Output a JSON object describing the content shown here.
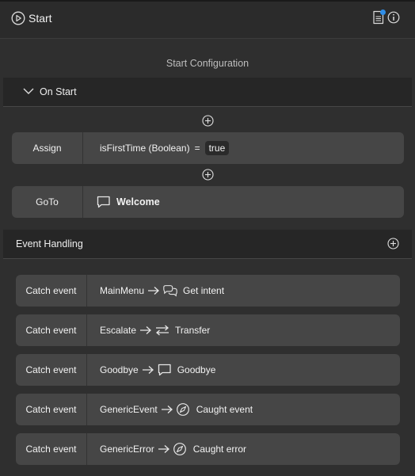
{
  "header": {
    "title": "Start",
    "play_icon": "play-circle-icon",
    "notes_icon": "document-icon",
    "info_icon": "info-icon",
    "accent_color": "#2f8ee8"
  },
  "section_caption": "Start Configuration",
  "on_start": {
    "label": "On Start",
    "assign": {
      "kind": "Assign",
      "expression": "isFirstTime (Boolean)",
      "operator": "=",
      "value": "true"
    },
    "goto": {
      "kind": "GoTo",
      "target": "Welcome",
      "target_icon": "speech-bubble-icon"
    }
  },
  "event_handling": {
    "label": "Event Handling",
    "events": [
      {
        "kind": "Catch event",
        "event": "MainMenu",
        "action": "Get intent",
        "icon": "chat-bubbles-icon"
      },
      {
        "kind": "Catch event",
        "event": "Escalate",
        "action": "Transfer",
        "icon": "transfer-icon"
      },
      {
        "kind": "Catch event",
        "event": "Goodbye",
        "action": "Goodbye",
        "icon": "speech-bubble-icon"
      },
      {
        "kind": "Catch event",
        "event": "GenericEvent",
        "action": "Caught event",
        "icon": "compass-icon"
      },
      {
        "kind": "Catch event",
        "event": "GenericError",
        "action": "Caught error",
        "icon": "compass-icon"
      }
    ]
  }
}
